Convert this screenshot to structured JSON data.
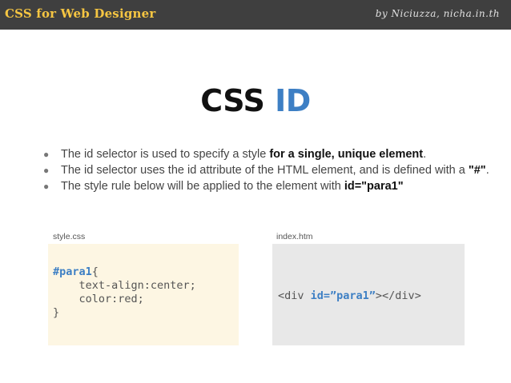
{
  "header": {
    "left_title": "CSS for Web Designer",
    "right_credit": "by Niciuzza, nicha.in.th"
  },
  "slide": {
    "title_part1": "CSS",
    "title_part2": "ID",
    "bullets": [
      {
        "plain": "The id selector is used to specify a style ",
        "bold": "for a single, unique element",
        "tail": "."
      },
      {
        "plain": "The id selector uses the id attribute of the HTML element, and is defined with a ",
        "bold": "\"#\"",
        "tail": "."
      },
      {
        "plain": "The style rule below will be applied to the element with ",
        "bold": "id=\"para1\"",
        "tail": ""
      }
    ],
    "css_label": "style.css",
    "html_label": "index.htm",
    "css_code": {
      "selector": "#para1",
      "open": "{",
      "line1": "    text-align:center;",
      "line2": "    color:red;",
      "close": "}"
    },
    "html_code": {
      "open": "<div ",
      "attr": "id=”para1”",
      "close": "></div>"
    }
  },
  "colors": {
    "accent": "#3d7fc4",
    "header_bg": "#3f3f3f",
    "header_title": "#f5c542",
    "css_box_bg": "#fdf6e3",
    "html_box_bg": "#e8e8e8"
  }
}
